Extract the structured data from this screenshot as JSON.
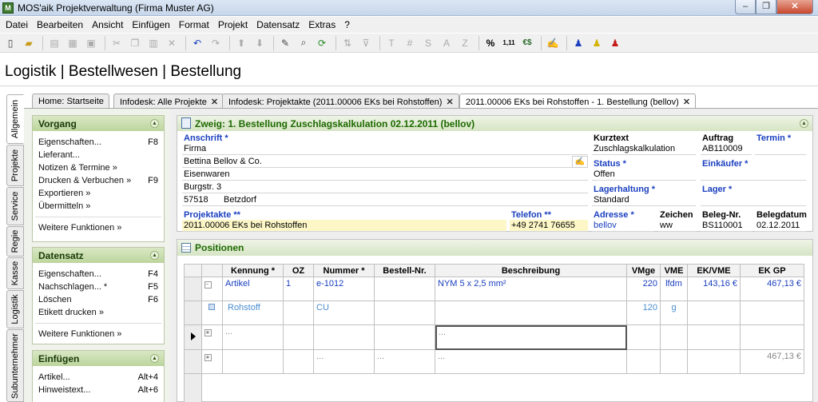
{
  "window": {
    "title": "MOS'aik Projektverwaltung (Firma Muster AG)",
    "min": "–",
    "max": "❐",
    "close": "✕"
  },
  "menu": [
    "Datei",
    "Bearbeiten",
    "Ansicht",
    "Einfügen",
    "Format",
    "Projekt",
    "Datensatz",
    "Extras",
    "?"
  ],
  "toolbar": {
    "t1": "T",
    "t2": "#",
    "t3": "S",
    "t4": "A",
    "t5": "Z",
    "pct": "%",
    "num": "1,11",
    "eur": "€$"
  },
  "breadcrumb": "Logistik | Bestellwesen | Bestellung",
  "vtabs": [
    "Allgemein",
    "Projekte",
    "Service",
    "Regie",
    "Kasse",
    "Logistik",
    "Subunternehmer"
  ],
  "tabs": [
    {
      "label": "Home: Startseite",
      "close": ""
    },
    {
      "label": "Infodesk: Alle Projekte",
      "close": "✕"
    },
    {
      "label": "Infodesk: Projektakte (2011.00006 EKs bei Rohstoffen)",
      "close": "✕"
    },
    {
      "label": "2011.00006 EKs bei Rohstoffen - 1. Bestellung (bellov)",
      "close": "✕"
    }
  ],
  "panels": {
    "vorgang": {
      "title": "Vorgang",
      "items": [
        {
          "label": "Eigenschaften...",
          "key": "F8"
        },
        {
          "label": "Lieferant...",
          "key": ""
        },
        {
          "label": "Notizen & Termine »",
          "key": ""
        },
        {
          "label": "Drucken & Verbuchen »",
          "key": "F9"
        },
        {
          "label": "Exportieren »",
          "key": ""
        },
        {
          "label": "Übermitteln »",
          "key": ""
        }
      ],
      "more": "Weitere Funktionen »"
    },
    "datensatz": {
      "title": "Datensatz",
      "items": [
        {
          "label": "Eigenschaften...",
          "key": "F4"
        },
        {
          "label": "Nachschlagen... *",
          "key": "F5"
        },
        {
          "label": "Löschen",
          "key": "F6"
        },
        {
          "label": "Etikett drucken »",
          "key": ""
        }
      ],
      "more": "Weitere Funktionen »"
    },
    "einfuegen": {
      "title": "Einfügen",
      "items": [
        {
          "label": "Artikel...",
          "key": "Alt+4"
        },
        {
          "label": "Hinweistext...",
          "key": "Alt+6"
        }
      ]
    }
  },
  "header": {
    "title": "Zweig: 1. Bestellung Zuschlagskalkulation 02.12.2011 (bellov)",
    "anschrift_label": "Anschrift *",
    "anschrift": [
      "Firma",
      "Bettina Bellov & Co.",
      "Eisenwaren",
      "Burgstr. 3"
    ],
    "plz": "57518",
    "ort": "Betzdorf",
    "projektakte_label": "Projektakte **",
    "projektakte": "2011.00006 EKs bei Rohstoffen",
    "telefon_label": "Telefon **",
    "telefon": "+49 2741 76655",
    "kurztext_label": "Kurztext",
    "kurztext": "Zuschlagskalkulation",
    "auftrag_label": "Auftrag",
    "auftrag": "AB110009",
    "termin_label": "Termin *",
    "termin": "",
    "status_label": "Status *",
    "status": "Offen",
    "einkaeufer_label": "Einkäufer *",
    "einkaeufer": "",
    "lagerhaltung_label": "Lagerhaltung *",
    "lagerhaltung": "Standard",
    "lager_label": "Lager *",
    "lager": "",
    "adresse_label": "Adresse *",
    "adresse": "bellov",
    "zeichen_label": "Zeichen",
    "zeichen": "ww",
    "belegnr_label": "Beleg-Nr.",
    "belegnr": "BS110001",
    "belegdatum_label": "Belegdatum",
    "belegdatum": "02.12.2011"
  },
  "positionen": {
    "title": "Positionen",
    "columns": [
      "Kennung *",
      "OZ",
      "Nummer *",
      "Bestell-Nr.",
      "Beschreibung",
      "VMge",
      "VME",
      "EK/VME",
      "EK GP"
    ],
    "rows": [
      {
        "kennung": "Artikel",
        "oz": "1",
        "nummer": "e-1012",
        "bestell": "",
        "beschreibung": "NYM 5 x 2,5 mm²",
        "vmge": "220",
        "vme": "lfdm",
        "ekvme": "143,16 €",
        "ekgp": "467,13 €"
      },
      {
        "kennung": "Rohstoff",
        "oz": "",
        "nummer": "CU",
        "bestell": "",
        "beschreibung": "",
        "vmge": "120",
        "vme": "g",
        "ekvme": "",
        "ekgp": ""
      },
      {
        "kennung": "...",
        "oz": "",
        "nummer": "",
        "bestell": "",
        "beschreibung": "...",
        "vmge": "",
        "vme": "",
        "ekvme": "",
        "ekgp": ""
      },
      {
        "kennung": "",
        "oz": "",
        "nummer": "...",
        "bestell": "...",
        "beschreibung": "...",
        "vmge": "",
        "vme": "",
        "ekvme": "",
        "ekgp": "467,13 €"
      }
    ]
  }
}
